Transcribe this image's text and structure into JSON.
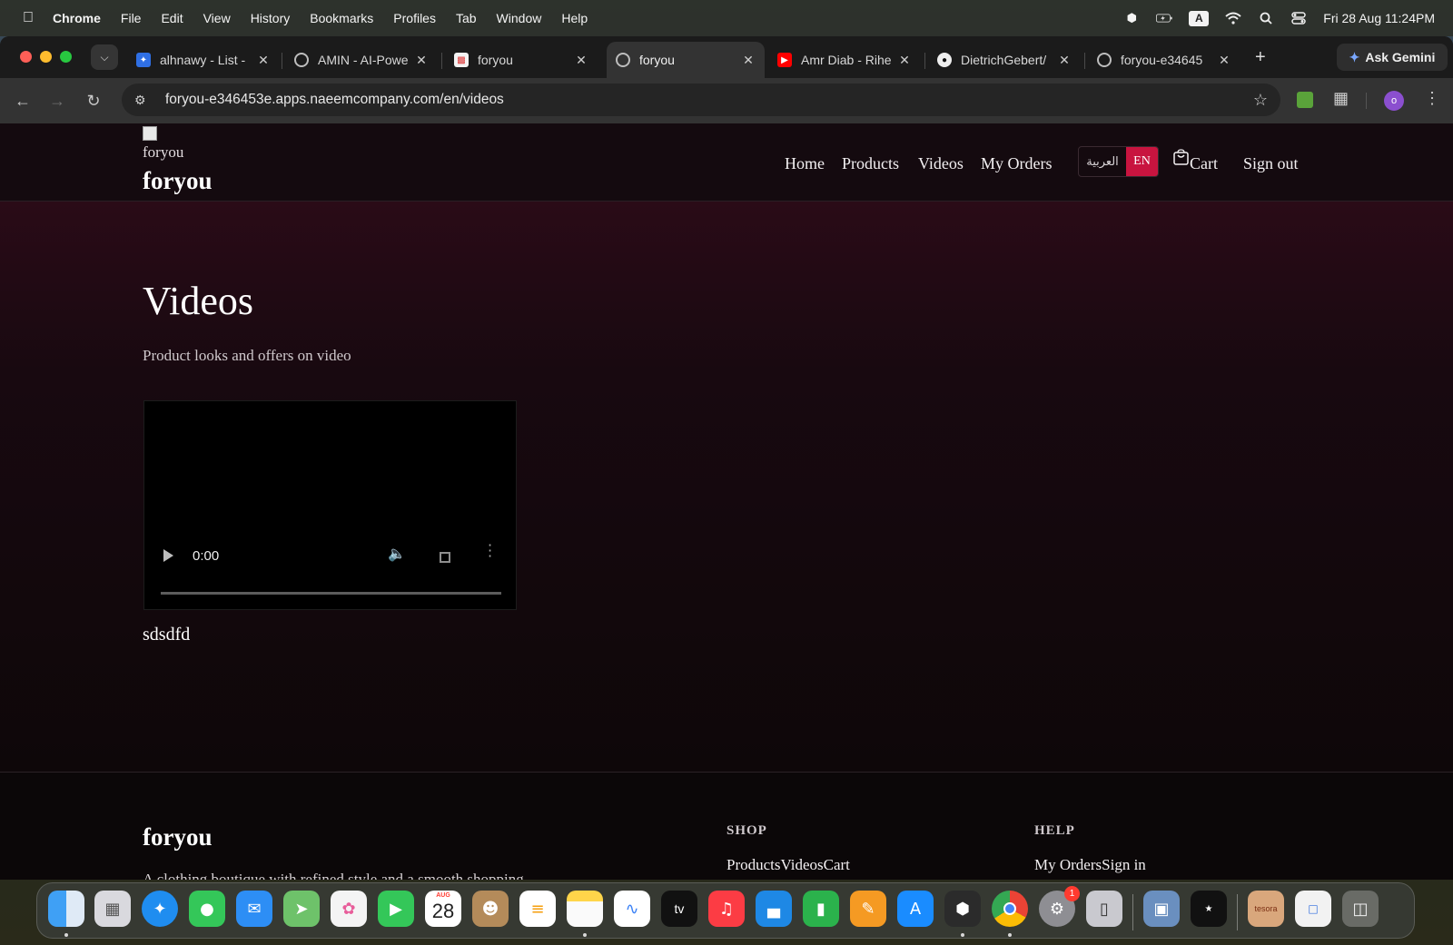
{
  "menubar": {
    "app_name": "Chrome",
    "items": [
      "File",
      "Edit",
      "View",
      "History",
      "Bookmarks",
      "Profiles",
      "Tab",
      "Window",
      "Help"
    ],
    "input_source": "A",
    "datetime": "Fri 28 Aug  11:24PM"
  },
  "browser": {
    "tabs": [
      {
        "title": "alhnawy - List -",
        "icon": "jira-icon",
        "active": false
      },
      {
        "title": "AMIN - AI-Powe",
        "icon": "globe-icon",
        "active": false
      },
      {
        "title": "foryou",
        "icon": "shopping-bag-icon",
        "active": false
      },
      {
        "title": "foryou",
        "icon": "globe-icon",
        "active": true
      },
      {
        "title": "Amr Diab - Rihe",
        "icon": "youtube-icon",
        "active": false
      },
      {
        "title": "DietrichGebert/",
        "icon": "github-icon",
        "active": false
      },
      {
        "title": "foryou-e34645",
        "icon": "globe-icon",
        "active": false
      }
    ],
    "new_tab_label": "+",
    "gemini_label": "Ask Gemini",
    "url": "foryou-e346453e.apps.naeemcompany.com/en/videos",
    "profile_initial": "o"
  },
  "site": {
    "logo_alt": "foryou",
    "brand": "foryou",
    "nav": {
      "home": "Home",
      "products": "Products",
      "videos": "Videos",
      "my_orders": "My Orders",
      "lang_ar": "العربية",
      "lang_en": "EN",
      "cart": "Cart",
      "sign_out": "Sign out"
    },
    "page_title": "Videos",
    "page_subtitle": "Product looks and offers on video",
    "video": {
      "time": "0:00",
      "progress": 0,
      "caption": "sdsdfd"
    },
    "footer": {
      "brand": "foryou",
      "description": "A clothing boutique with refined style and a smooth shopping",
      "shop_heading": "SHOP",
      "shop_links": [
        "Products",
        "Videos",
        "Cart"
      ],
      "help_heading": "HELP",
      "help_links": [
        "My Orders",
        "Sign in"
      ]
    }
  },
  "dock": {
    "calendar_month": "AUG",
    "calendar_day": "28",
    "settings_badge": "1",
    "apps": [
      "finder-icon",
      "launchpad-icon",
      "safari-icon",
      "messages-icon",
      "mail-icon",
      "maps-icon",
      "photos-icon",
      "facetime-icon",
      "calendar-icon",
      "contacts-icon",
      "reminders-icon",
      "notes-icon",
      "freeform-icon",
      "appletv-icon",
      "music-icon",
      "keynote-icon",
      "numbers-icon",
      "pages-icon",
      "appstore-icon",
      "box-icon",
      "chrome-icon",
      "system-settings-icon",
      "iphone-mirroring-icon",
      "preview-icon",
      "gta-icon",
      "tesora-icon",
      "jpeg-file-icon",
      "trash-icon"
    ],
    "tv_label": "tv",
    "tesora_label": "tesora"
  }
}
